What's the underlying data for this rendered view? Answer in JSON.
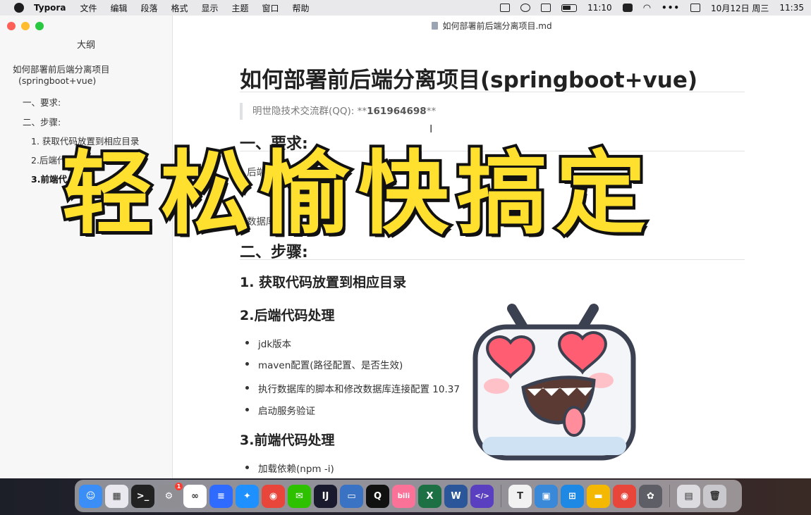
{
  "menubar": {
    "app_name": "Typora",
    "menus": [
      "文件",
      "编辑",
      "段落",
      "格式",
      "显示",
      "主题",
      "窗口",
      "帮助"
    ],
    "clock_small": "11:10",
    "date": "10月12日 周三",
    "time": "11:35"
  },
  "window": {
    "title": "如何部署前后端分离项目.md"
  },
  "sidebar": {
    "title": "大纲",
    "items": [
      {
        "label": "如何部署前后端分离项目"
      },
      {
        "label": "(springboot+vue)"
      },
      {
        "label": "一、要求:"
      },
      {
        "label": "二、步骤:"
      },
      {
        "label": "1. 获取代码放置到相应目录"
      },
      {
        "label": "2.后端代码处"
      },
      {
        "label": "3.前端代"
      }
    ]
  },
  "doc": {
    "h1": "如何部署前后端分离项目(springboot+vue)",
    "quote_prefix": "明世隐技术交流群(QQ):",
    "quote_stars_open": "**",
    "quote_number": "161964698",
    "quote_stars_close": "**",
    "section1": "一、要求:",
    "req_frag1": "后端:JD",
    "req_frag2": "数据库",
    "section2": "二、步骤:",
    "step1": "1. 获取代码放置到相应目录",
    "step2": "2.后端代码处理",
    "backend_items": [
      "jdk版本",
      "maven配置(路径配置、是否生效)",
      "执行数据库的脚本和修改数据库连接配置 10.37",
      "启动服务验证"
    ],
    "step3": "3.前端代码处理",
    "frontend_items": [
      "加载依赖(npm -i)"
    ]
  },
  "overlay": {
    "text": "轻松愉快搞定"
  },
  "dock": {
    "apps": [
      {
        "name": "Finder",
        "icon": "finder-icon",
        "color": "#3b8ef5",
        "glyph": "☺"
      },
      {
        "name": "Launchpad",
        "icon": "launchpad-icon",
        "color": "#e8e8ee",
        "glyph": "▦"
      },
      {
        "name": "Terminal",
        "icon": "terminal-icon",
        "color": "#222222",
        "glyph": ">_"
      },
      {
        "name": "System Preferences",
        "icon": "gear-icon",
        "color": "#8e8e93",
        "glyph": "⚙",
        "badge": "1"
      },
      {
        "name": "Baidu Netdisk",
        "icon": "cloud-icon",
        "color": "#ffffff",
        "glyph": "∞"
      },
      {
        "name": "Notes",
        "icon": "notes-icon",
        "color": "#2f6bff",
        "glyph": "≡"
      },
      {
        "name": "Safari",
        "icon": "safari-icon",
        "color": "#1e90ff",
        "glyph": "✦"
      },
      {
        "name": "Chrome",
        "icon": "chrome-icon",
        "color": "#e8463b",
        "glyph": "◉"
      },
      {
        "name": "WeChat",
        "icon": "wechat-icon",
        "color": "#2dc100",
        "glyph": "✉"
      },
      {
        "name": "IntelliJ IDEA",
        "icon": "intellij-icon",
        "color": "#1a1a2e",
        "glyph": "IJ"
      },
      {
        "name": "Navicat",
        "icon": "database-icon",
        "color": "#3a72c4",
        "glyph": "▭"
      },
      {
        "name": "QQ",
        "icon": "qq-icon",
        "color": "#111111",
        "glyph": "Q"
      },
      {
        "name": "Bilibili",
        "icon": "bilibili-icon",
        "color": "#fb7299",
        "glyph": "bili"
      },
      {
        "name": "Excel",
        "icon": "excel-icon",
        "color": "#1d7044",
        "glyph": "X"
      },
      {
        "name": "Word",
        "icon": "word-icon",
        "color": "#2b579a",
        "glyph": "W"
      },
      {
        "name": "Code Editor",
        "icon": "code-icon",
        "color": "#5a3fc0",
        "glyph": "</>"
      },
      {
        "name": "Typora",
        "icon": "typora-icon",
        "color": "#f2f2f2",
        "glyph": "T"
      },
      {
        "name": "Screen Recorder",
        "icon": "recorder-icon",
        "color": "#3a88d8",
        "glyph": "▣"
      },
      {
        "name": "Windows",
        "icon": "windows-icon",
        "color": "#1e88e5",
        "glyph": "⊞"
      },
      {
        "name": "Folder",
        "icon": "folder-icon",
        "color": "#f5b800",
        "glyph": "▬"
      },
      {
        "name": "Chrome Canary",
        "icon": "chrome-canary-icon",
        "color": "#e8463b",
        "glyph": "◉"
      },
      {
        "name": "Photo Tool",
        "icon": "photo-tool-icon",
        "color": "#5e5e66",
        "glyph": "✿"
      },
      {
        "name": "Downloads",
        "icon": "document-stack-icon",
        "color": "#dcdce0",
        "glyph": "▤"
      },
      {
        "name": "Trash",
        "icon": "trash-icon",
        "color": "#c8c8cd",
        "glyph": "🗑"
      }
    ]
  }
}
